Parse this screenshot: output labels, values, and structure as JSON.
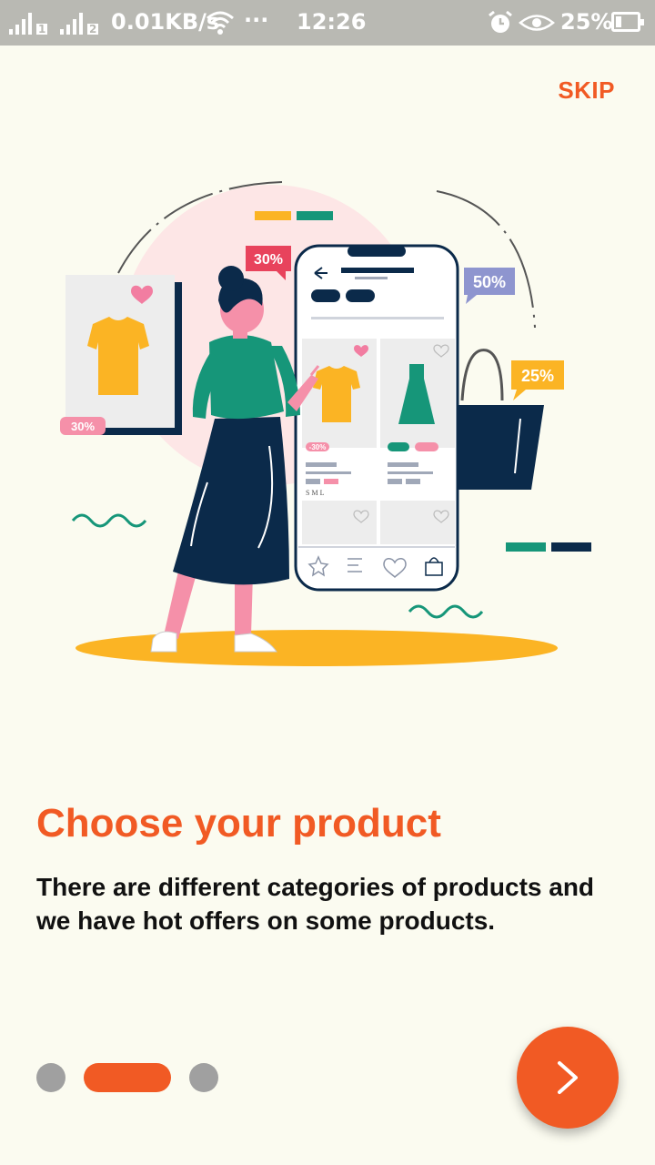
{
  "status_bar": {
    "sim1": "1",
    "sim2": "2",
    "network_speed": "0.01KB/s",
    "more": "···",
    "time": "12:26",
    "battery": "25%"
  },
  "skip_label": "SKIP",
  "illustration": {
    "tag_top": "30%",
    "tag_left": "30%",
    "tag_right1": "50%",
    "tag_right2": "25%",
    "card_discount": "-30%",
    "sizes": "S  M  L"
  },
  "onboarding": {
    "title": "Choose your product",
    "description": "There are different categories of products and we have hot offers on some products.",
    "page_index": 2,
    "page_count": 3
  },
  "colors": {
    "accent": "#f15a24",
    "background": "#fbfbf0",
    "status_bar": "#b9b9b3",
    "dot_inactive": "#a0a0a0",
    "illustration_yellow": "#fbb424",
    "illustration_green": "#169679",
    "illustration_navy": "#0b2a4a",
    "illustration_pink": "#f590a9"
  }
}
